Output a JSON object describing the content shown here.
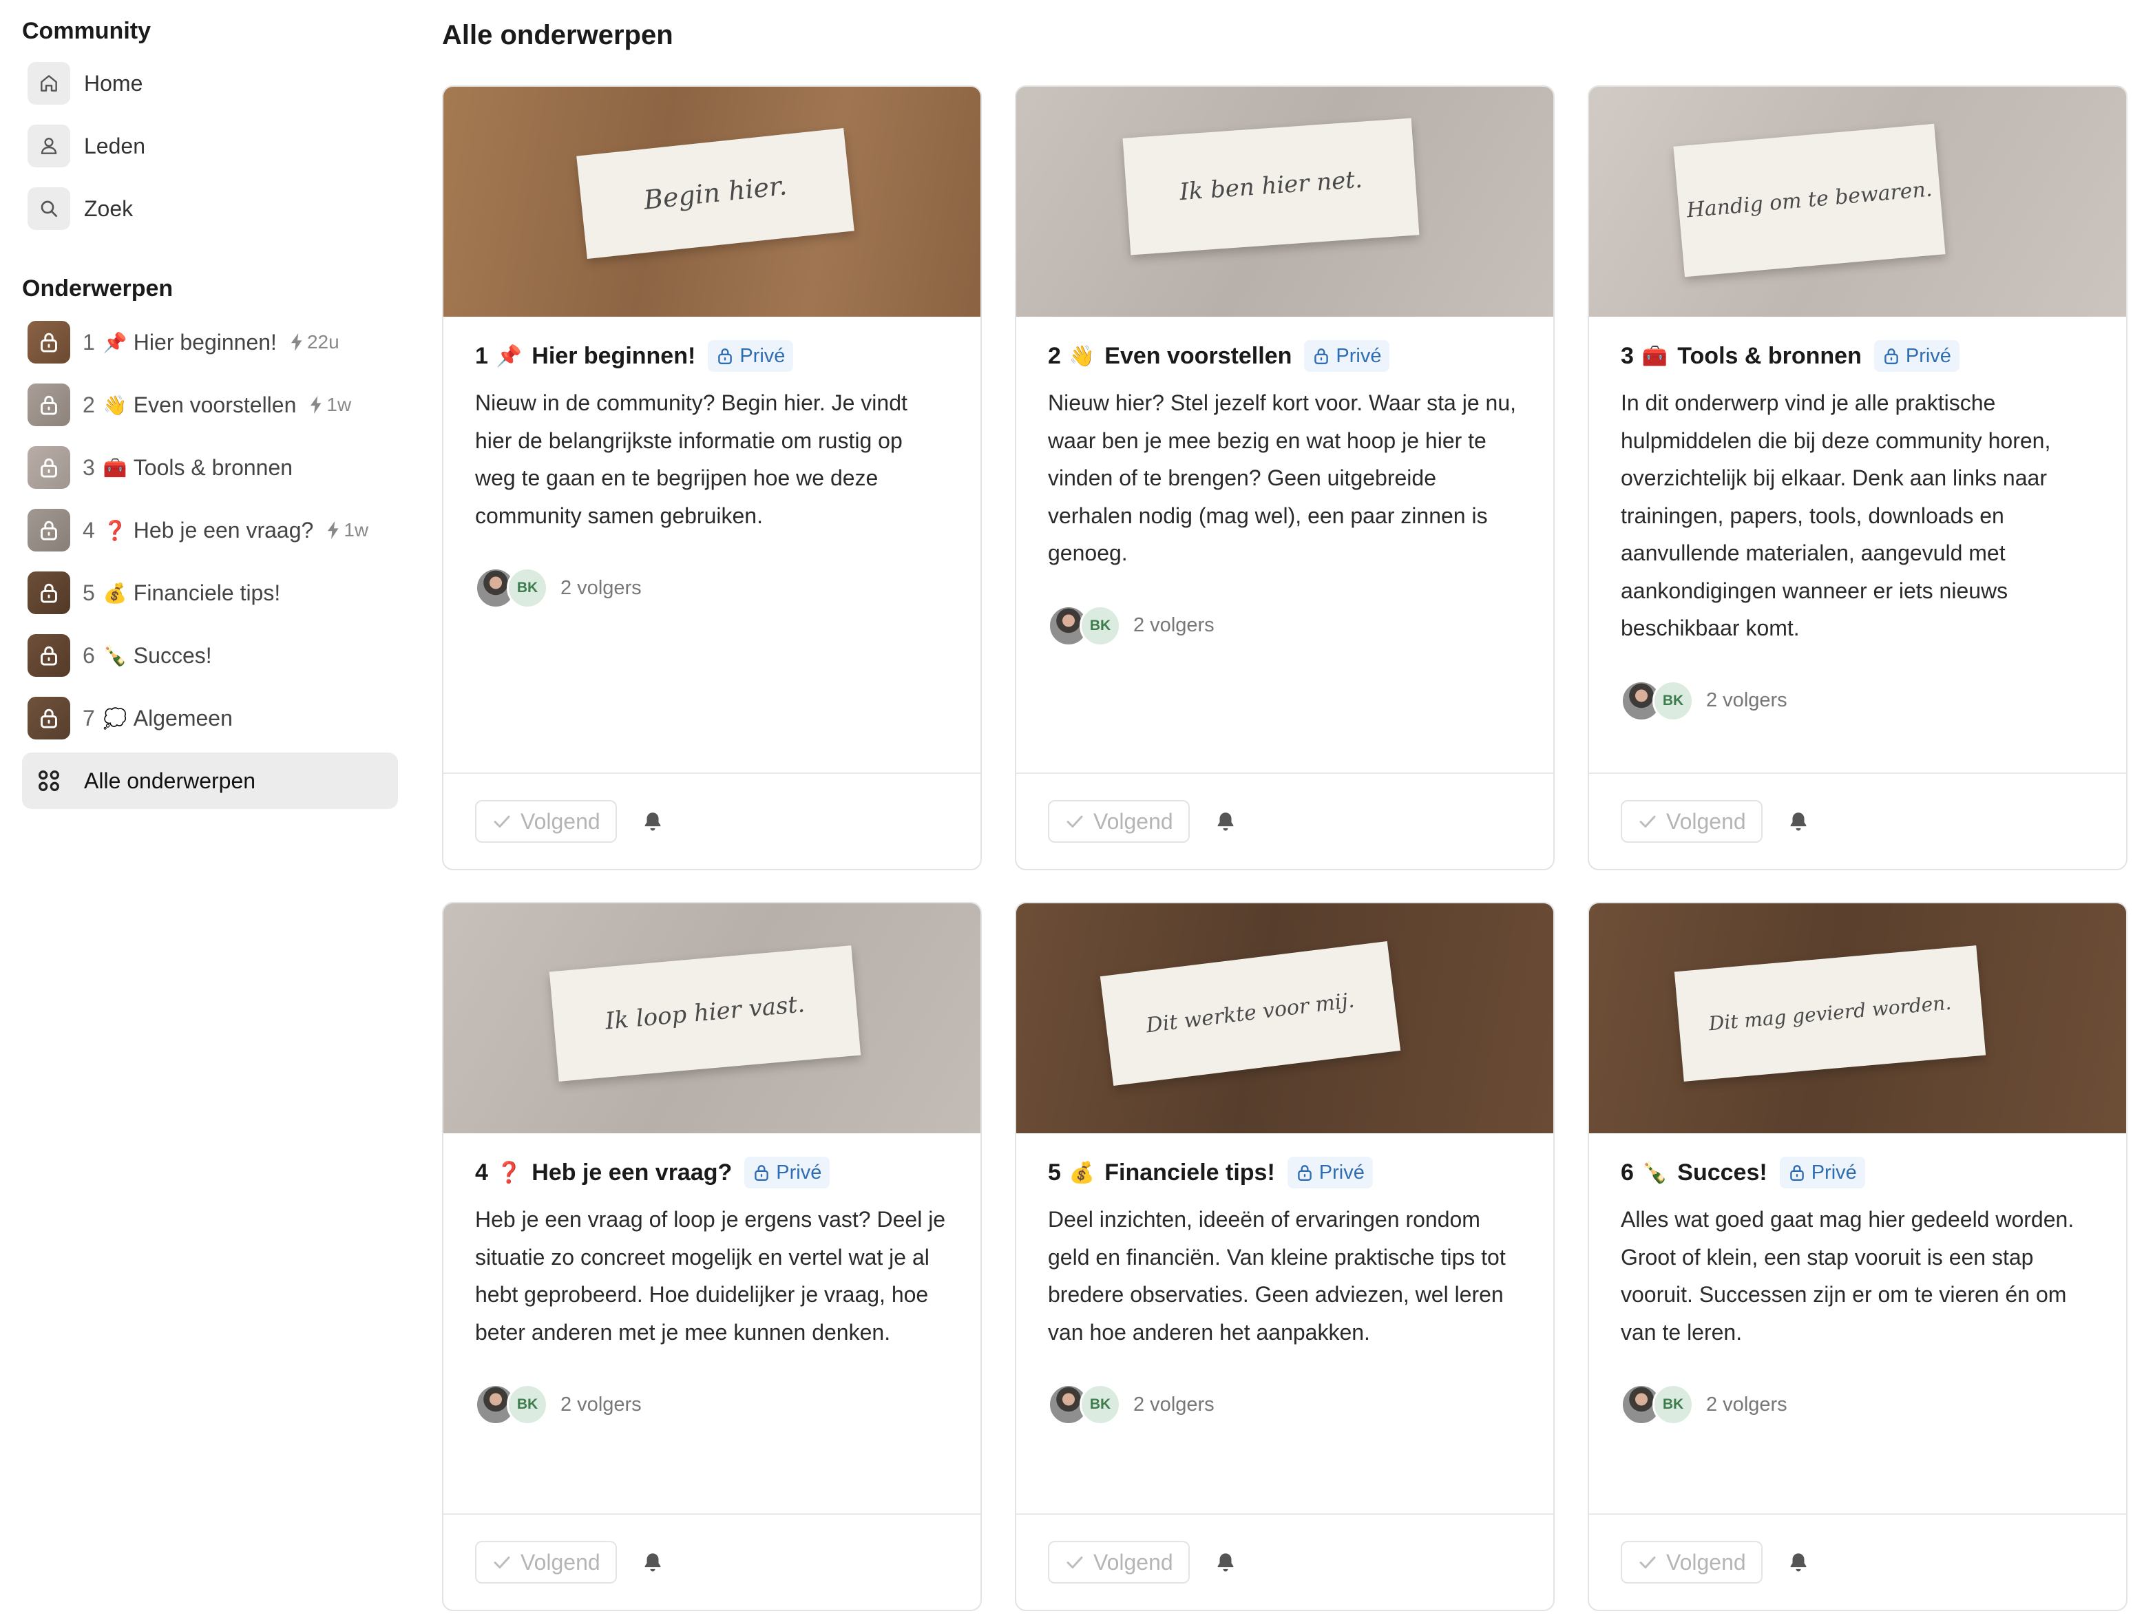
{
  "sidebar": {
    "community_heading": "Community",
    "nav": [
      {
        "label": "Home",
        "icon": "home-icon"
      },
      {
        "label": "Leden",
        "icon": "user-icon"
      },
      {
        "label": "Zoek",
        "icon": "search-icon"
      }
    ],
    "topics_heading": "Onderwerpen",
    "topics": [
      {
        "num": "1",
        "emoji": "📌",
        "label": "Hier beginnen!",
        "activity": "22u"
      },
      {
        "num": "2",
        "emoji": "👋",
        "label": "Even voorstellen",
        "activity": "1w"
      },
      {
        "num": "3",
        "emoji": "🧰",
        "label": "Tools & bronnen",
        "activity": ""
      },
      {
        "num": "4",
        "emoji": "❓",
        "label": "Heb je een vraag?",
        "activity": "1w"
      },
      {
        "num": "5",
        "emoji": "💰",
        "label": "Financiele tips!",
        "activity": ""
      },
      {
        "num": "6",
        "emoji": "🍾",
        "label": "Succes!",
        "activity": ""
      },
      {
        "num": "7",
        "emoji": "💭",
        "label": "Algemeen",
        "activity": ""
      }
    ],
    "all_topics_label": "Alle onderwerpen"
  },
  "main": {
    "title": "Alle onderwerpen",
    "private_label": "Privé",
    "follow_label": "Volgend",
    "followers_text": "2 volgers",
    "avatar_initials": "BK",
    "cards": [
      {
        "num": "1",
        "emoji": "📌",
        "title": "Hier beginnen!",
        "note_text": "Begin hier.",
        "description": "Nieuw in de community? Begin hier. Je vindt hier de belangrijkste informatie om rustig op weg te gaan en te begrijpen hoe we deze community samen gebruiken."
      },
      {
        "num": "2",
        "emoji": "👋",
        "title": "Even voorstellen",
        "note_text": "Ik ben hier net.",
        "description": "Nieuw hier? Stel jezelf kort voor. Waar sta je nu, waar ben je mee bezig en wat hoop je hier te vinden of te brengen? Geen uitgebreide verhalen nodig (mag wel), een paar zinnen is genoeg."
      },
      {
        "num": "3",
        "emoji": "🧰",
        "title": "Tools & bronnen",
        "note_text": "Handig om te bewaren.",
        "description": "In dit onderwerp vind je alle praktische hulpmiddelen die bij deze community horen, overzichtelijk bij elkaar. Denk aan links naar trainingen, papers, tools, downloads en aanvullende materialen, aangevuld met aankondigingen wanneer er iets nieuws beschikbaar komt."
      },
      {
        "num": "4",
        "emoji": "❓",
        "title": "Heb je een vraag?",
        "note_text": "Ik loop hier vast.",
        "description": "Heb je een vraag of loop je ergens vast? Deel je situatie zo concreet mogelijk en vertel wat je al hebt geprobeerd. Hoe duidelijker je vraag, hoe beter anderen met je mee kunnen denken."
      },
      {
        "num": "5",
        "emoji": "💰",
        "title": "Financiele tips!",
        "note_text": "Dit werkte voor mij.",
        "description": "Deel inzichten, ideeën of ervaringen rondom geld en financiën. Van kleine praktische tips tot bredere observaties. Geen adviezen, wel leren van hoe anderen het aanpakken."
      },
      {
        "num": "6",
        "emoji": "🍾",
        "title": "Succes!",
        "note_text": "Dit mag gevierd worden.",
        "description": "Alles wat goed gaat mag hier gedeeld worden. Groot of klein, een stap vooruit is een stap vooruit. Successen zijn er om te vieren én om van te leren."
      }
    ]
  },
  "colors": {
    "badge_text": "#2f6db3",
    "badge_bg": "#eef4fb",
    "wood": "#9c7a5b",
    "concrete": "#c4bcb6"
  }
}
